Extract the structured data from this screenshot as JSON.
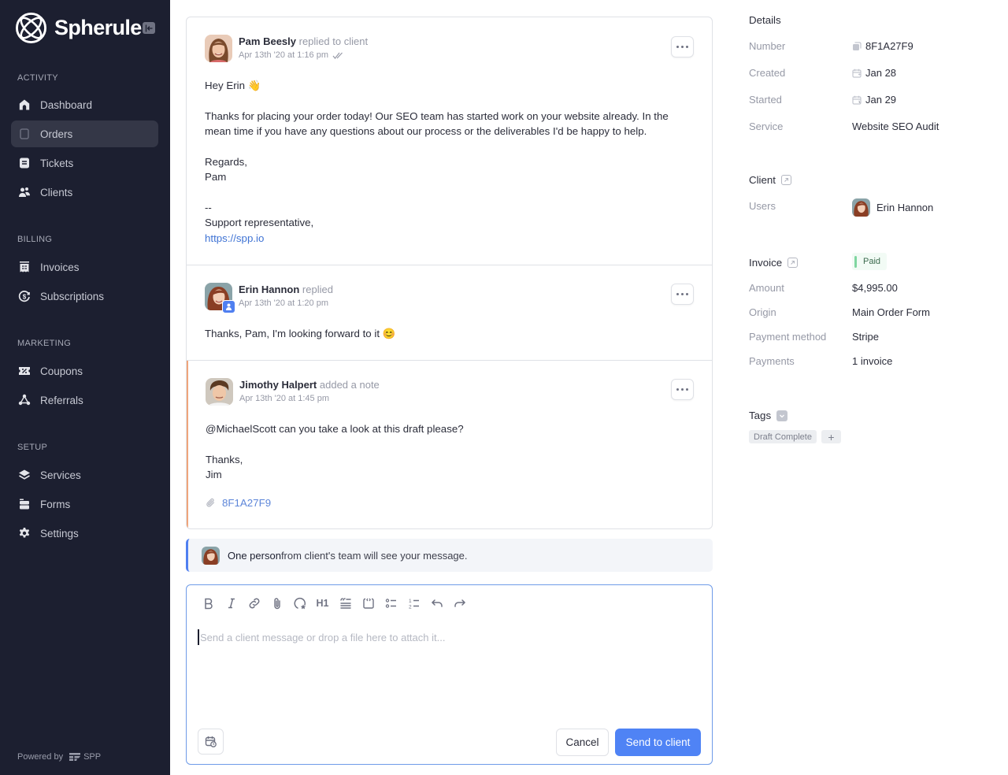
{
  "brand": {
    "name": "Spherule",
    "collapse_icon": "collapse-sidebar-icon"
  },
  "sidebar": {
    "sections": [
      {
        "label": "ACTIVITY",
        "items": [
          {
            "label": "Dashboard",
            "icon": "home-icon",
            "active": false
          },
          {
            "label": "Orders",
            "icon": "orders-icon",
            "active": true
          },
          {
            "label": "Tickets",
            "icon": "tickets-icon",
            "active": false
          },
          {
            "label": "Clients",
            "icon": "clients-icon",
            "active": false
          }
        ]
      },
      {
        "label": "BILLING",
        "items": [
          {
            "label": "Invoices",
            "icon": "invoices-icon",
            "active": false
          },
          {
            "label": "Subscriptions",
            "icon": "subscriptions-icon",
            "active": false
          }
        ]
      },
      {
        "label": "MARKETING",
        "items": [
          {
            "label": "Coupons",
            "icon": "coupons-icon",
            "active": false
          },
          {
            "label": "Referrals",
            "icon": "referrals-icon",
            "active": false
          }
        ]
      },
      {
        "label": "SETUP",
        "items": [
          {
            "label": "Services",
            "icon": "services-icon",
            "active": false
          },
          {
            "label": "Forms",
            "icon": "forms-icon",
            "active": false
          },
          {
            "label": "Settings",
            "icon": "settings-icon",
            "active": false
          }
        ]
      }
    ],
    "powered_by": "Powered by",
    "powered_brand": "SPP"
  },
  "messages": [
    {
      "author": "Pam Beesly",
      "action": "replied to client",
      "time": "Apr 13th '20 at 1:16 pm",
      "read": true,
      "type": "reply",
      "body": {
        "greeting": "Hey Erin 👋",
        "para": "Thanks for placing your order today! Our SEO team has started work on your website already. In the mean time if you have any questions about our process or the deliverables I'd be happy to help.",
        "signoff": "Regards,\nPam",
        "sig": "--\nSupport representative,",
        "link": "https://spp.io"
      }
    },
    {
      "author": "Erin Hannon",
      "action": "replied",
      "time": "Apr 13th '20 at 1:20 pm",
      "type": "client",
      "body": {
        "text": "Thanks, Pam, I'm looking forward to it 😊"
      }
    },
    {
      "author": "Jimothy Halpert",
      "action": "added a note",
      "time": "Apr 13th '20 at 1:45 pm",
      "type": "note",
      "body": {
        "text": "@MichaelScott can you take a look at this draft please?",
        "signoff": "Thanks,\nJim",
        "attachment": "8F1A27F9"
      }
    }
  ],
  "visibility": {
    "bold": "One person",
    "rest": " from client's team will see your message."
  },
  "editor": {
    "toolbar": [
      "bold",
      "italic",
      "link",
      "attach",
      "mention",
      "heading-1",
      "quote",
      "code",
      "bullet-list",
      "numbered-list",
      "undo",
      "redo"
    ],
    "h1_label": "H1",
    "placeholder": "Send a client message or drop a file here to attach it...",
    "value": "",
    "cancel_label": "Cancel",
    "send_label": "Send to client"
  },
  "details": {
    "heading": "Details",
    "rows": [
      {
        "label": "Number",
        "value": "8F1A27F9",
        "icon": "copy-icon"
      },
      {
        "label": "Created",
        "value": "Jan 28",
        "icon": "calendar-icon"
      },
      {
        "label": "Started",
        "value": "Jan 29",
        "icon": "calendar-icon"
      },
      {
        "label": "Service",
        "value": "Website SEO Audit"
      }
    ],
    "client": {
      "heading": "Client",
      "users_label": "Users",
      "user_name": "Erin Hannon"
    },
    "invoice": {
      "heading": "Invoice",
      "status": "Paid",
      "rows": [
        {
          "label": "Amount",
          "value": "$4,995.00"
        },
        {
          "label": "Origin",
          "value": "Main Order Form"
        },
        {
          "label": "Payment method",
          "value": "Stripe"
        },
        {
          "label": "Payments",
          "value": "1 invoice"
        }
      ]
    },
    "tags": {
      "heading": "Tags",
      "items": [
        "Draft Complete"
      ],
      "add_label": "+"
    }
  },
  "colors": {
    "sidebar_bg": "#1c1f30",
    "accent": "#4f83f5",
    "note_border": "#f0a57b",
    "paid_green": "#7fd6a0",
    "link": "#3f73d4"
  }
}
